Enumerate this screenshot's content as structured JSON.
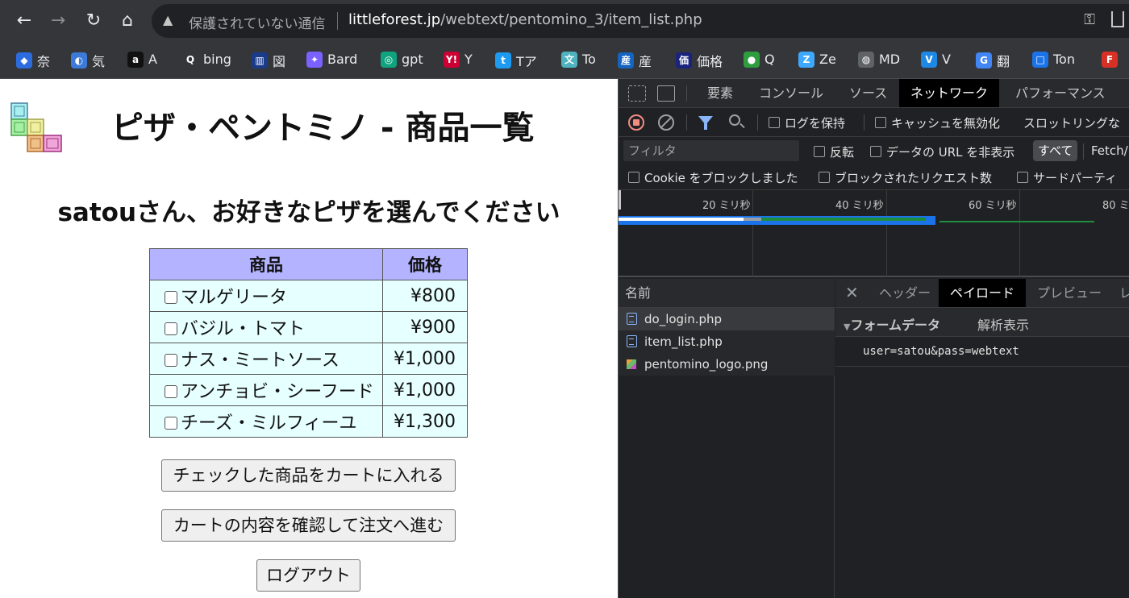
{
  "browser": {
    "insecure_label": "保護されていない通信",
    "url_host": "littleforest.jp",
    "url_path": "/webtext/pentomino_3/item_list.php"
  },
  "bookmarks": [
    {
      "label": "奈",
      "icon": "cube-icon",
      "color": "#2d6cdf"
    },
    {
      "label": "気",
      "icon": "weather-icon",
      "color": "#3b7ad9"
    },
    {
      "label": "A",
      "icon": "amazon-icon",
      "color": "#111111"
    },
    {
      "label": "bing",
      "icon": "search-icon",
      "color": "#35363a"
    },
    {
      "label": "図",
      "icon": "library-icon",
      "color": "#1a3a8a"
    },
    {
      "label": "Bard",
      "icon": "sparkle-icon",
      "color": "#7b61ff"
    },
    {
      "label": "gpt",
      "icon": "openai-icon",
      "color": "#10a37f"
    },
    {
      "label": "Y",
      "icon": "yahoo-icon",
      "color": "#cc0033"
    },
    {
      "label": "Tア",
      "icon": "twitter-icon",
      "color": "#1d9bf0"
    },
    {
      "label": "To",
      "icon": "translate-icon",
      "color": "#4fb3bf"
    },
    {
      "label": "産",
      "icon": "building-icon",
      "color": "#1565c0"
    },
    {
      "label": "価格",
      "icon": "kakaku-icon",
      "color": "#1a237e"
    },
    {
      "label": "Q",
      "icon": "quiz-icon",
      "color": "#2e9d3e"
    },
    {
      "label": "Ze",
      "icon": "zenn-icon",
      "color": "#3ea8ff"
    },
    {
      "label": "MD",
      "icon": "globe-icon",
      "color": "#5f6368"
    },
    {
      "label": "V",
      "icon": "video-icon",
      "color": "#1e88e5"
    },
    {
      "label": "翻",
      "icon": "google-translate-icon",
      "color": "#4285f4"
    },
    {
      "label": "Ton",
      "icon": "ton-icon",
      "color": "#1a73e8"
    },
    {
      "label": "",
      "icon": "feed-icon",
      "color": "#d93025"
    }
  ],
  "page": {
    "title": "ピザ・ペントミノ - 商品一覧",
    "greeting": "satouさん、お好きなピザを選んでください",
    "table": {
      "headers": [
        "商品",
        "価格"
      ],
      "rows": [
        {
          "name": "マルゲリータ",
          "price": "¥800"
        },
        {
          "name": "バジル・トマト",
          "price": "¥900"
        },
        {
          "name": "ナス・ミートソース",
          "price": "¥1,000"
        },
        {
          "name": "アンチョビ・シーフード",
          "price": "¥1,000"
        },
        {
          "name": "チーズ・ミルフィーユ",
          "price": "¥1,300"
        }
      ]
    },
    "buttons": {
      "add_to_cart": "チェックした商品をカートに入れる",
      "checkout": "カートの内容を確認して注文へ進む",
      "logout": "ログアウト"
    }
  },
  "devtools": {
    "tabs": [
      "要素",
      "コンソール",
      "ソース",
      "ネットワーク",
      "パフォーマンス"
    ],
    "active_tab": "ネットワーク",
    "preserve_log": "ログを保持",
    "disable_cache": "キャッシュを無効化",
    "throttling": "スロットリングな",
    "filter_placeholder": "フィルタ",
    "invert": "反転",
    "hide_data_urls": "データの URL を非表示",
    "type_all": "すべて",
    "type_fetch": "Fetch/",
    "blocked_cookies": "Cookie をブロックしました",
    "blocked_requests": "ブロックされたリクエスト数",
    "third_party": "サードパーティ",
    "timeline_ticks": [
      "20 ミリ秒",
      "40 ミリ秒",
      "60 ミリ秒",
      "80 ミ"
    ],
    "name_header": "名前",
    "requests": [
      "do_login.php",
      "item_list.php",
      "pentomino_logo.png"
    ],
    "detail_tabs": [
      "ヘッダー",
      "ペイロード",
      "プレビュー",
      "レ"
    ],
    "form_data_title": "フォームデータ",
    "view_parsed": "解析表示",
    "payload": "user=satou&pass=webtext"
  }
}
